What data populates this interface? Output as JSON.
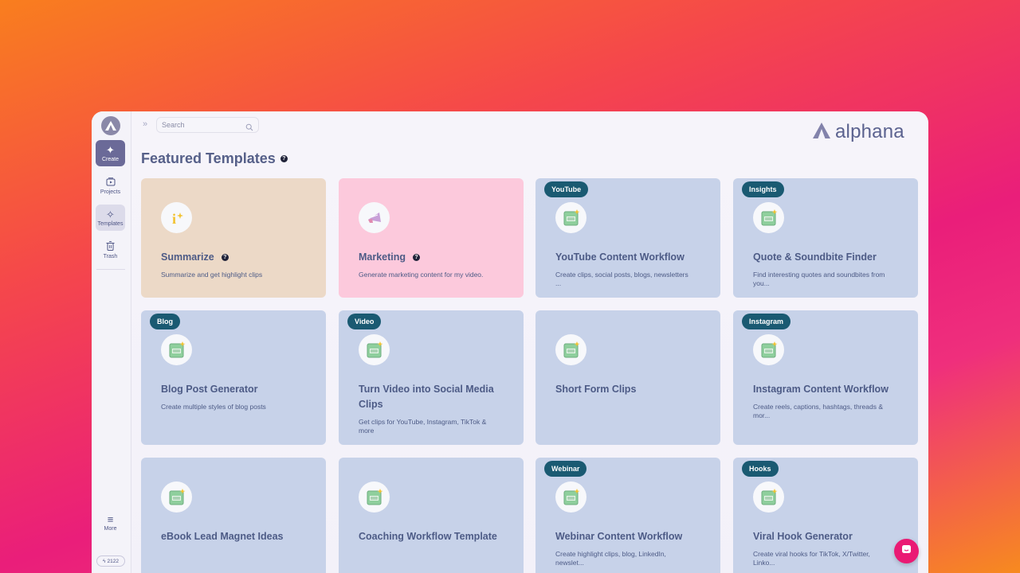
{
  "sidebar": {
    "create": "Create",
    "projects": "Projects",
    "templates": "Templates",
    "trash": "Trash",
    "more": "More",
    "credits": "2122"
  },
  "search": {
    "placeholder": "Search"
  },
  "brand": {
    "name": "alphana"
  },
  "page_title": "Featured Templates",
  "colors": {
    "accent": "#6b6a98",
    "tag": "#1a5a72",
    "card": "#c7d2e9",
    "summarize_card": "#ecd9c7",
    "marketing_card": "#fcc9dc",
    "chat": "#ea1a74"
  },
  "cards": [
    {
      "title": "Summarize",
      "desc": "Summarize and get highlight clips",
      "tag": "",
      "icon": "bulb-icon"
    },
    {
      "title": "Marketing",
      "desc": "Generate marketing content for my video.",
      "tag": "",
      "icon": "megaphone-icon"
    },
    {
      "title": "YouTube Content Workflow",
      "desc": "Create clips, social posts, blogs, newsletters ...",
      "tag": "YouTube",
      "icon": "document-icon"
    },
    {
      "title": "Quote & Soundbite Finder",
      "desc": "Find interesting quotes and soundbites from you...",
      "tag": "Insights",
      "icon": "document-icon"
    },
    {
      "title": "Blog Post Generator",
      "desc": "Create multiple styles of blog posts",
      "tag": "Blog",
      "icon": "document-icon"
    },
    {
      "title": "Turn Video into Social Media Clips",
      "desc": "Get clips for YouTube, Instagram, TikTok & more",
      "tag": "Video",
      "icon": "document-icon"
    },
    {
      "title": "Short Form Clips",
      "desc": "",
      "tag": "",
      "icon": "document-icon"
    },
    {
      "title": "Instagram Content Workflow",
      "desc": "Create reels, captions, hashtags, threads & mor...",
      "tag": "Instagram",
      "icon": "document-icon"
    },
    {
      "title": "eBook Lead Magnet Ideas",
      "desc": "",
      "tag": "",
      "icon": "document-icon"
    },
    {
      "title": "Coaching Workflow Template",
      "desc": "",
      "tag": "",
      "icon": "document-icon"
    },
    {
      "title": "Webinar Content Workflow",
      "desc": "Create highlight clips, blog, LinkedIn, newslet...",
      "tag": "Webinar",
      "icon": "document-icon"
    },
    {
      "title": "Viral Hook Generator",
      "desc": "Create viral hooks for TikTok, X/Twitter, Linko...",
      "tag": "Hooks",
      "icon": "document-icon"
    }
  ]
}
